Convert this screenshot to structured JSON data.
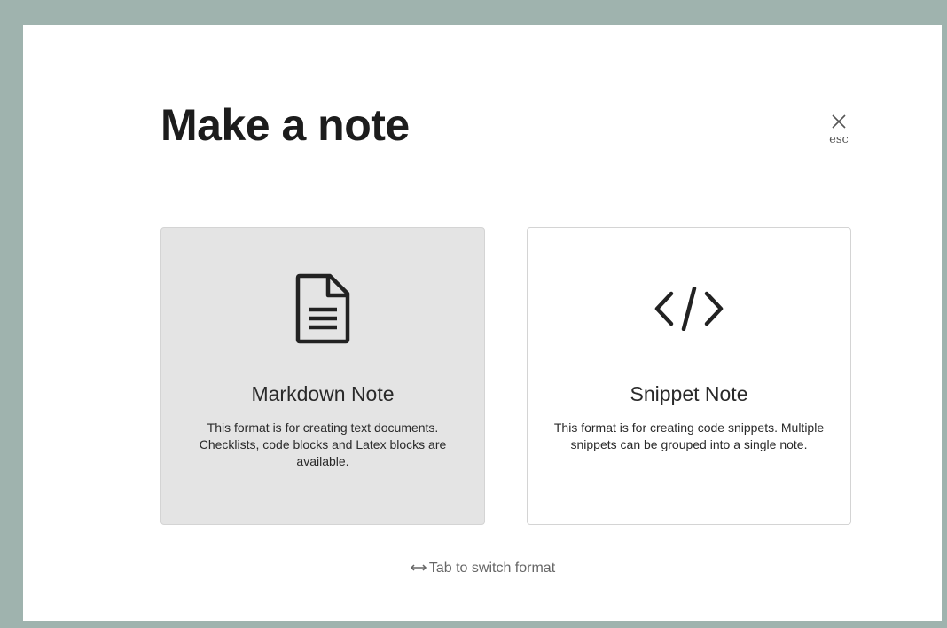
{
  "dialog": {
    "title": "Make a note",
    "close": {
      "icon": "close-icon",
      "hint": "esc"
    }
  },
  "cards": [
    {
      "icon": "document-icon",
      "title": "Markdown Note",
      "description": "This format is for creating text documents. Checklists, code blocks and Latex blocks are available.",
      "selected": true
    },
    {
      "icon": "code-icon",
      "title": "Snippet Note",
      "description": "This format is for creating code snippets. Multiple snippets can be grouped into a single note.",
      "selected": false
    }
  ],
  "footer": {
    "hint_icon": "left-right-arrow-icon",
    "hint": "Tab to switch format"
  },
  "colors": {
    "background": "#9fb3ae",
    "panel": "#ffffff",
    "selected_card": "#e4e4e4"
  }
}
